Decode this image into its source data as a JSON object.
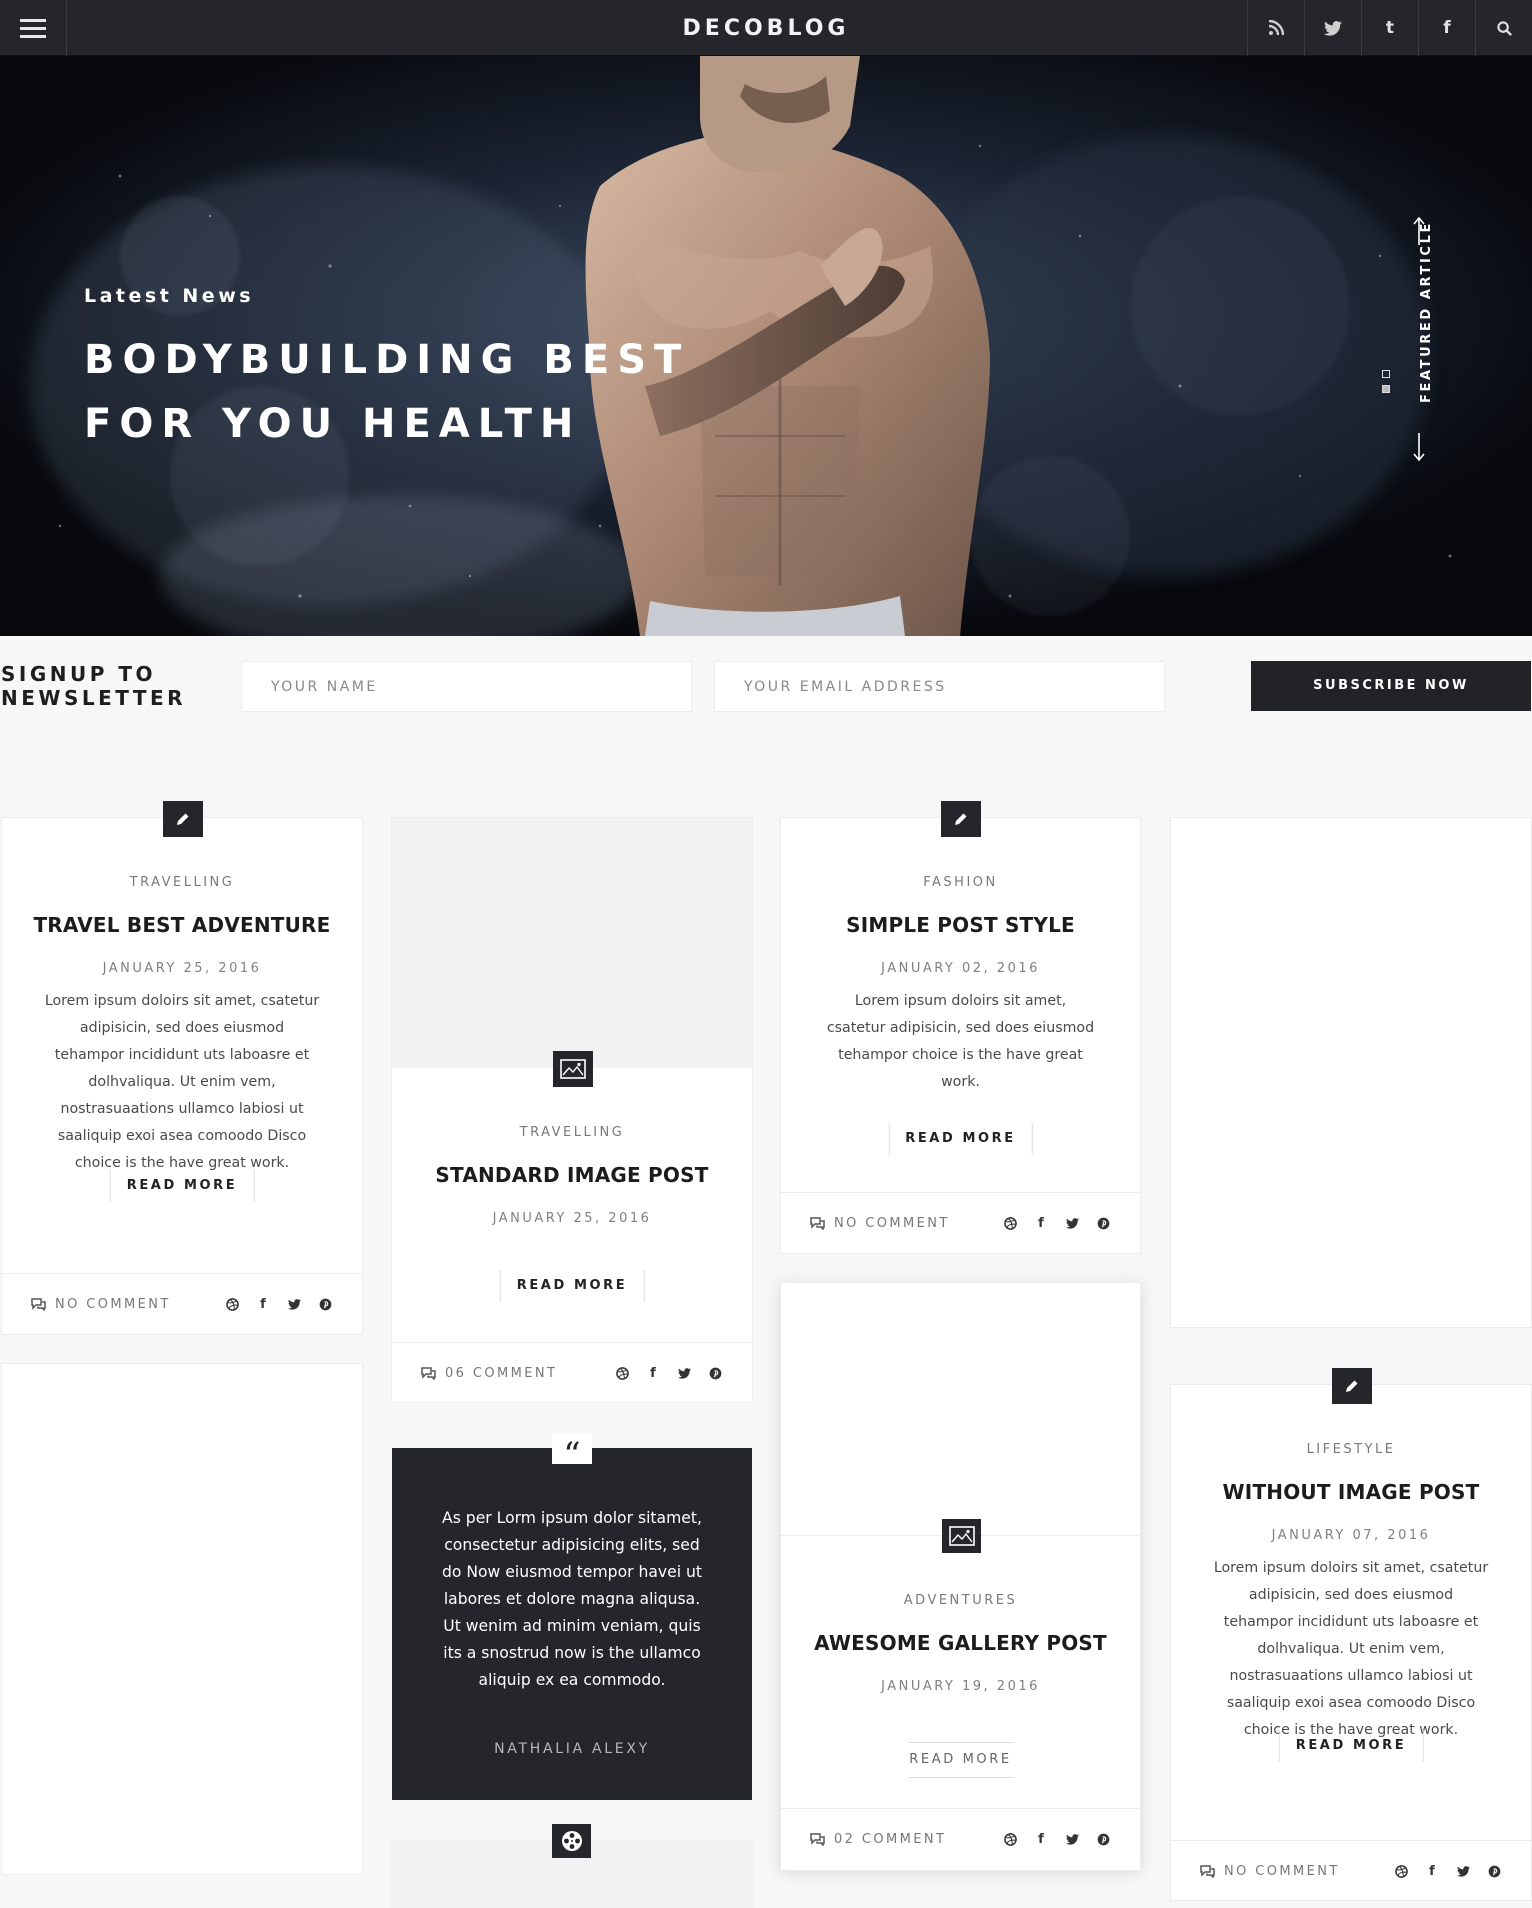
{
  "header": {
    "logo": "DECOBLOG",
    "menu_icon": "hamburger-menu-icon",
    "social_icons": [
      "rss-icon",
      "twitter-icon",
      "tumblr-icon",
      "facebook-icon",
      "search-icon"
    ]
  },
  "hero": {
    "kicker": "Latest News",
    "title_line1": "BODYBUILDING BEST",
    "title_line2": "FOR YOU HEALTH",
    "featured_label": "FEATURED ARTICLE",
    "slide_count": 2,
    "active_slide": 2
  },
  "newsletter": {
    "title_line1": "SIGNUP TO",
    "title_line2": "NEWSLETTER",
    "name_placeholder": "YOUR NAME",
    "email_placeholder": "YOUR EMAIL ADDRESS",
    "button_label": "SUBSCRIBE NOW"
  },
  "posts": {
    "travel": {
      "category": "TRAVELLING",
      "title": "TRAVEL BEST ADVENTURE",
      "date": "JANUARY 25, 2016",
      "excerpt": "Lorem ipsum doloirs sit amet, csatetur adipisicin, sed does eiusmod tehampor incididunt uts laboasre et dolhvaliqua. Ut enim vem, nostrasuaations ullamco labiosi ut saaliquip exoi asea comoodo Disco choice is the have great work.",
      "read_more": "READ MORE",
      "comments": "NO COMMENT",
      "badge_icon": "pencil-icon"
    },
    "standard_image": {
      "category": "TRAVELLING",
      "title": "STANDARD IMAGE POST",
      "date": "JANUARY 25, 2016",
      "read_more": "READ MORE",
      "comments": "06 COMMENT",
      "badge_icon": "image-icon"
    },
    "simple": {
      "category": "FASHION",
      "title": "SIMPLE POST STYLE",
      "date": "JANUARY 02, 2016",
      "excerpt": "Lorem ipsum doloirs sit amet, csatetur adipisicin, sed does eiusmod tehampor choice is the have great work.",
      "read_more": "READ MORE",
      "comments": "NO COMMENT",
      "badge_icon": "pencil-icon"
    },
    "quote": {
      "text": "As per Lorm ipsum dolor sitamet, consectetur adipisicing elits, sed do Now eiusmod tempor havei ut labores et dolore magna aliqusa. Ut wenim ad minim veniam, quis its a snostrud now is the ullamco aliquip ex ea commodo.",
      "author": "NATHALIA ALEXY",
      "badge_icon": "quote-icon"
    },
    "gallery": {
      "category": "ADVENTURES",
      "title": "AWESOME GALLERY POST",
      "date": "JANUARY 19, 2016",
      "read_more": "READ MORE",
      "comments": "02 COMMENT",
      "badge_icon": "image-icon"
    },
    "without_image": {
      "category": "LIFESTYLE",
      "title": "WITHOUT IMAGE POST",
      "date": "JANUARY 07, 2016",
      "excerpt": "Lorem ipsum doloirs sit amet, csatetur adipisicin, sed does eiusmod tehampor incididunt uts laboasre et dolhvaliqua. Ut enim vem, nostrasuaations ullamco labiosi ut saaliquip exoi asea comoodo Disco choice is the have great work.",
      "read_more": "READ MORE",
      "comments": "NO COMMENT",
      "badge_icon": "pencil-icon"
    },
    "video": {
      "badge_icon": "film-reel-icon"
    }
  },
  "share_icons": [
    "dribbble-icon",
    "facebook-icon",
    "twitter-icon",
    "pinterest-icon"
  ],
  "colors": {
    "dark": "#25262b",
    "page_bg": "#f7f7f8",
    "card_bg": "#ffffff",
    "text_muted": "#7a7a7a"
  }
}
